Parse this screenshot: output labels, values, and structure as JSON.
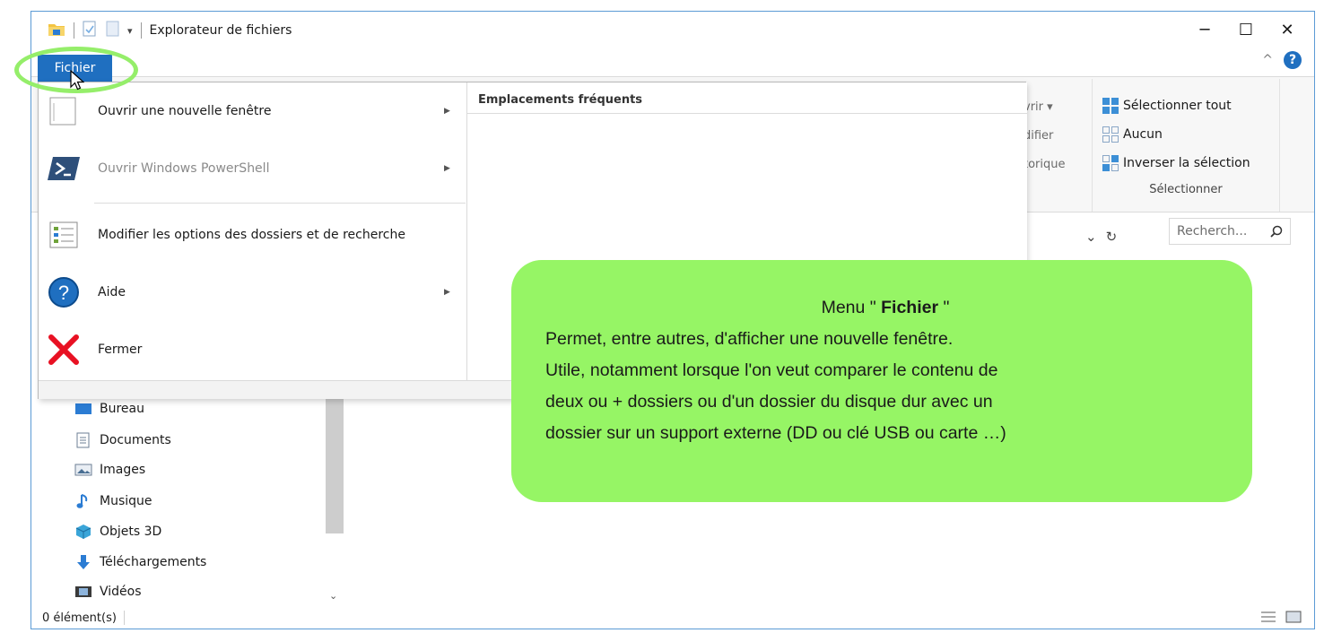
{
  "window": {
    "title": "Explorateur de fichiers",
    "minimize_glyph": "─",
    "maximize_glyph": "☐",
    "close_glyph": "✕"
  },
  "ribbon": {
    "help_glyph": "?",
    "collapse_glyph": "^",
    "partial_open": "vrir ▾",
    "partial_modify": "difier",
    "partial_history": "torique",
    "select_group": {
      "select_all": "Sélectionner tout",
      "select_none": "Aucun",
      "invert": "Inverser la sélection",
      "title": "Sélectionner"
    }
  },
  "search": {
    "placeholder": "Recherch...",
    "refresh_glyph": "↻",
    "dropdown_glyph": "⌄"
  },
  "file_menu": {
    "tab_label": "Fichier",
    "items": [
      {
        "label": "Ouvrir une nouvelle fenêtre",
        "icon": "new-window-icon",
        "submenu": true,
        "disabled": false
      },
      {
        "label": "Ouvrir Windows PowerShell",
        "icon": "powershell-icon",
        "submenu": true,
        "disabled": true
      },
      {
        "label": "Modifier les options des dossiers et de recherche",
        "icon": "folder-options-icon",
        "submenu": false,
        "disabled": false
      },
      {
        "label": "Aide",
        "icon": "help-icon",
        "submenu": true,
        "disabled": false
      },
      {
        "label": "Fermer",
        "icon": "close-icon",
        "submenu": false,
        "disabled": false
      }
    ],
    "frequent_title": "Emplacements fréquents"
  },
  "nav": {
    "items": [
      {
        "label": "Bureau",
        "icon": "desktop-icon"
      },
      {
        "label": "Documents",
        "icon": "documents-icon"
      },
      {
        "label": "Images",
        "icon": "pictures-icon"
      },
      {
        "label": "Musique",
        "icon": "music-icon"
      },
      {
        "label": "Objets 3D",
        "icon": "3d-objects-icon"
      },
      {
        "label": "Téléchargements",
        "icon": "downloads-icon"
      },
      {
        "label": "Vidéos",
        "icon": "videos-icon"
      }
    ]
  },
  "status": {
    "count": "0 élément(s)"
  },
  "callout": {
    "title_prefix": "Menu \" ",
    "title_bold": "Fichier",
    "title_suffix": " \"",
    "lines": [
      "Permet, entre autres, d'afficher une nouvelle fenêtre.",
      "Utile, notamment lorsque l'on veut comparer le contenu de",
      "deux ou + dossiers ou d'un dossier du disque dur avec un",
      "dossier sur un support externe (DD ou clé USB ou carte …)"
    ]
  },
  "colors": {
    "accent": "#1f6fc0",
    "callout_bg": "#96f565",
    "ring": "#95ee6a",
    "close_red": "#e81123",
    "powershell": "#2e4f7a"
  }
}
